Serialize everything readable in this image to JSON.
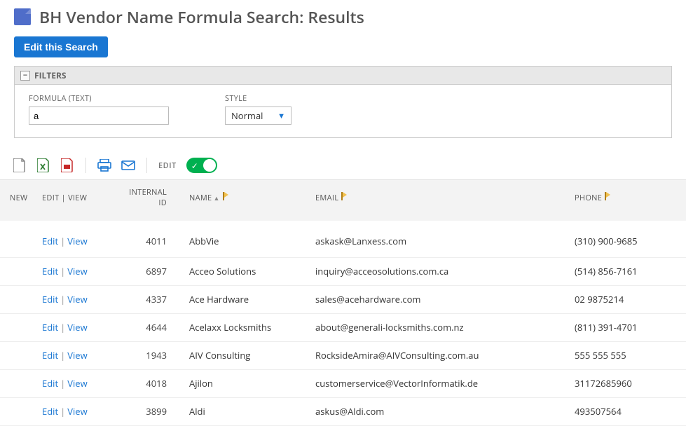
{
  "page": {
    "title": "BH Vendor Name Formula Search: Results",
    "edit_search_btn": "Edit this Search"
  },
  "filters": {
    "header": "FILTERS",
    "formula": {
      "label": "FORMULA (TEXT)",
      "value": "a"
    },
    "style": {
      "label": "STYLE",
      "value": "Normal"
    }
  },
  "toolbar": {
    "edit_label": "EDIT"
  },
  "columns": {
    "new": "NEW",
    "editview": "EDIT | VIEW",
    "internal": "INTERNAL ID",
    "name": "NAME",
    "email": "EMAIL",
    "phone": "PHONE"
  },
  "actions": {
    "edit": "Edit",
    "view": "View"
  },
  "rows": [
    {
      "internal_id": "4011",
      "name": "AbbVie",
      "email": "askask@Lanxess.com",
      "phone": "(310) 900-9685"
    },
    {
      "internal_id": "6897",
      "name": "Acceo Solutions",
      "email": "inquiry@acceosolutions.com.ca",
      "phone": "(514) 856-7161"
    },
    {
      "internal_id": "4337",
      "name": "Ace Hardware",
      "email": "sales@acehardware.com",
      "phone": "02 9875214"
    },
    {
      "internal_id": "4644",
      "name": "Acelaxx Locksmiths",
      "email": "about@generali-locksmiths.com.nz",
      "phone": "(811) 391-4701"
    },
    {
      "internal_id": "1943",
      "name": "AIV Consulting",
      "email": "RocksideAmira@AIVConsulting.com.au",
      "phone": "555 555 555"
    },
    {
      "internal_id": "4018",
      "name": "Ajilon",
      "email": "customerservice@VectorInformatik.de",
      "phone": "31172685960"
    },
    {
      "internal_id": "3899",
      "name": "Aldi",
      "email": "askus@Aldi.com",
      "phone": "493507564"
    }
  ]
}
